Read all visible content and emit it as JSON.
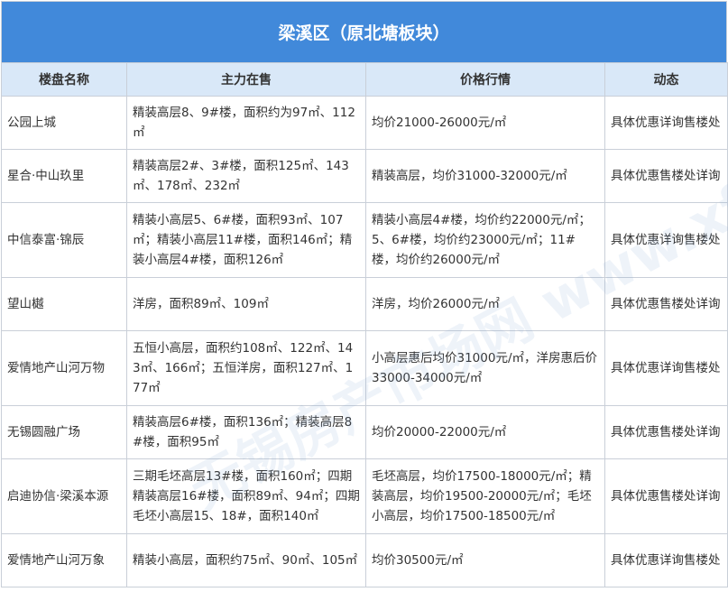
{
  "title": "梁溪区（原北塘板块）",
  "headers": [
    "楼盘名称",
    "主力在售",
    "价格行情",
    "动态"
  ],
  "rows": [
    {
      "name": "公园上城",
      "main": "精装高层8、9#楼，面积约为97㎡、112㎡",
      "price": "均价21000-26000元/㎡",
      "status": "具体优惠详询售楼处"
    },
    {
      "name": "星合·中山玖里",
      "main": "精装高层2#、3#楼，面积125㎡、143㎡、178㎡、232㎡",
      "price": "精装高层，均价31000-32000元/㎡",
      "status": "具体优惠售楼处详询"
    },
    {
      "name": "中信泰富·锦辰",
      "main": "精装小高层5、6#楼，面积93㎡、107㎡；精装小高层11#楼，面积146㎡；精装小高层4#楼，面积126㎡",
      "price": "精装小高层4#楼，均价约22000元/㎡；5、6#楼，均价约23000元/㎡；11#楼，均价约26000元/㎡",
      "status": "具体优惠详询售楼处"
    },
    {
      "name": "望山樾",
      "main": "洋房，面积89㎡、109㎡",
      "price": "洋房，均价26000元/㎡",
      "status": "具体优惠售楼处详询"
    },
    {
      "name": "爱情地产山河万物",
      "main": "五恒小高层，面积约108㎡、122㎡、143㎡、166㎡；五恒洋房，面积127㎡、177㎡",
      "price": "小高层惠后均价31000元/㎡，洋房惠后价33000-34000元/㎡",
      "status": "具体优惠详询售楼处"
    },
    {
      "name": "无锡圆融广场",
      "main": "精装高层6#楼，面积136㎡；精装高层8#楼，面积95㎡",
      "price": "均价20000-22000元/㎡",
      "status": "具体优惠售楼处详询"
    },
    {
      "name": "启迪协信·梁溪本源",
      "main": "三期毛坯高层13#楼，面积160㎡；四期精装高层16#楼，面积89㎡、94㎡；四期毛坯小高层15、18#，面积140㎡",
      "price": "毛坯高层，均价17500-18000元/㎡；精装高层，均价19500-20000元/㎡；毛坯小高层，均价17500-18500元/㎡",
      "status": "具体优惠售楼处详询"
    },
    {
      "name": "爱情地产山河万象",
      "main": "精装小高层，面积约75㎡、90㎡、105㎡",
      "price": "均价30500元/㎡",
      "status": "具体优惠详询售楼处"
    }
  ],
  "watermark": "无锡房产市场网 www.xfhouse.com"
}
